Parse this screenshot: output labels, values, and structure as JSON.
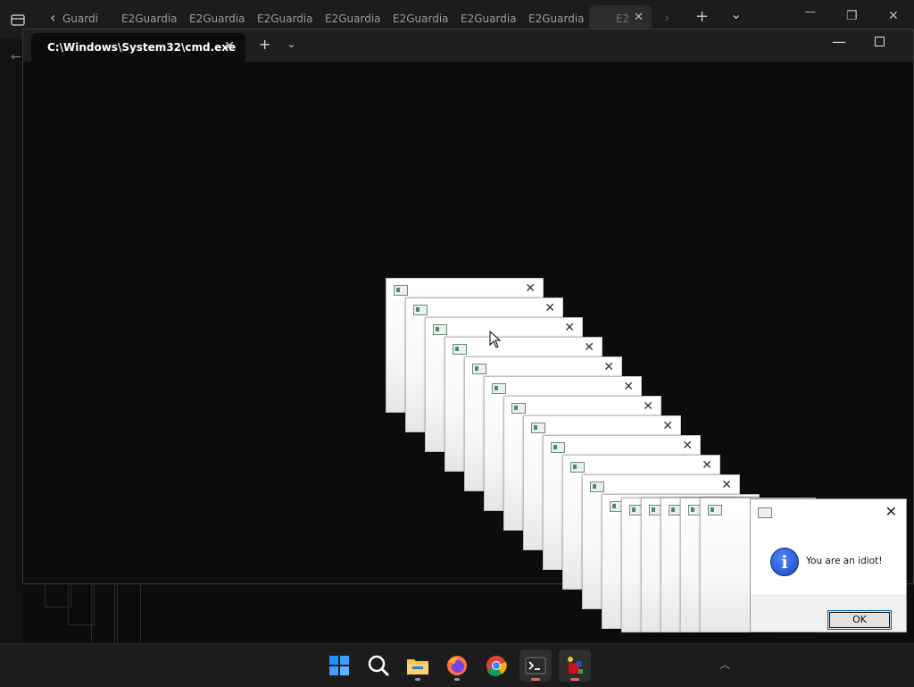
{
  "browser": {
    "tabs": [
      "Guardi",
      "E2Guardia",
      "E2Guardia",
      "E2Guardia",
      "E2Guardia",
      "E2Guardia",
      "E2Guardia",
      "E2Guardia"
    ],
    "active_tab": "E2",
    "controls": {
      "close_tab": "✕",
      "forward": "›",
      "new_tab": "+",
      "dropdown": "⌄",
      "minimize": "—",
      "restore": "❐",
      "close": "✕",
      "back": "‹"
    }
  },
  "terminal": {
    "tab_title": "C:\\Windows\\System32\\cmd.exe",
    "tab_close": "✕",
    "new_tab": "+",
    "dropdown": "⌄",
    "minimize": "—"
  },
  "popup_close_glyph": "✕",
  "dialog": {
    "message": "You are an idiot!",
    "ok_label": "OK",
    "close_glyph": "✕",
    "info_glyph": "i"
  },
  "taskbar": {
    "icons": [
      "windows-start-icon",
      "search-icon",
      "file-explorer-icon",
      "firefox-icon",
      "chrome-icon",
      "terminal-icon",
      "app-icon"
    ],
    "overflow": "︿"
  }
}
